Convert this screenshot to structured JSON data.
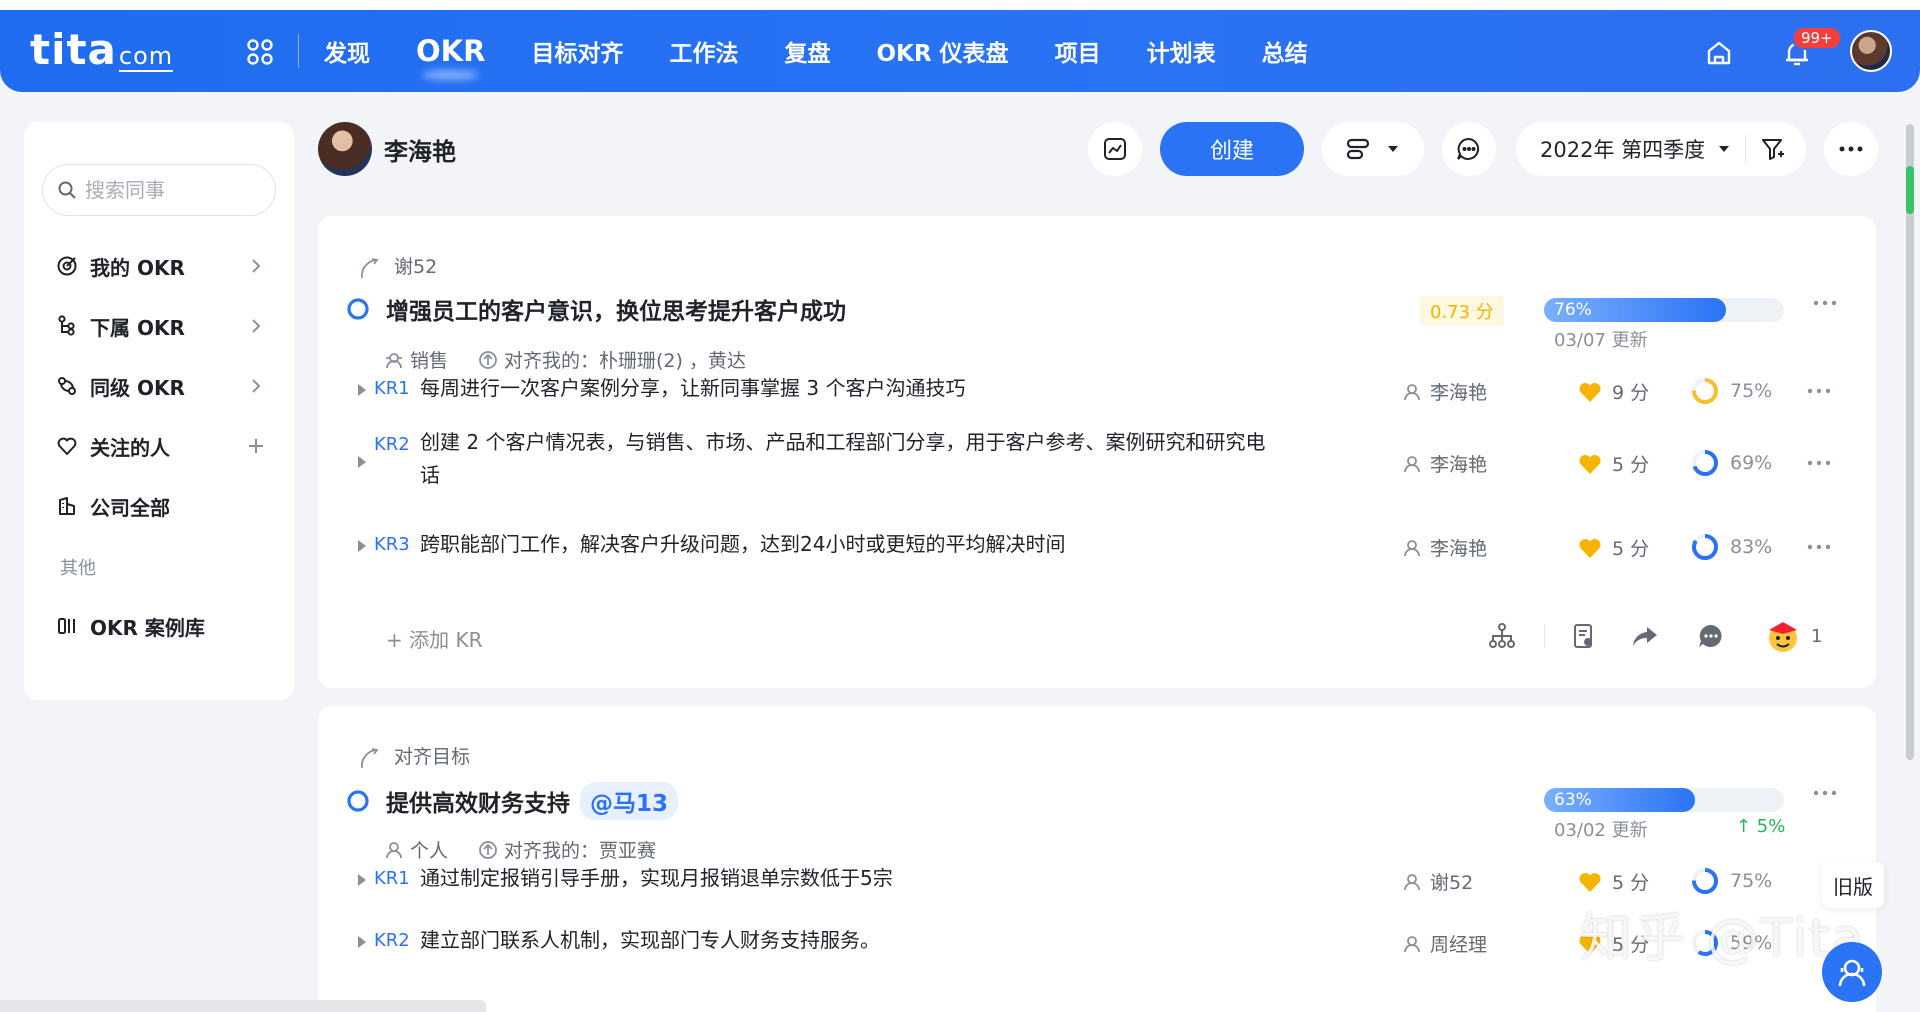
{
  "topbar": {
    "logo_main": "tita",
    "logo_suffix": "com",
    "nav": [
      "发现",
      "OKR",
      "目标对齐",
      "工作法",
      "复盘",
      "OKR 仪表盘",
      "项目",
      "计划表",
      "总结"
    ],
    "active_nav": "OKR",
    "notification_badge": "99+"
  },
  "sidebar": {
    "search_placeholder": "搜索同事",
    "items": [
      {
        "label": "我的 OKR",
        "icon": "target-icon"
      },
      {
        "label": "下属 OKR",
        "icon": "org-tree-icon"
      },
      {
        "label": "同级 OKR",
        "icon": "peers-icon"
      },
      {
        "label": "关注的人",
        "icon": "heart-icon"
      },
      {
        "label": "公司全部",
        "icon": "building-icon"
      }
    ],
    "section_other": "其他",
    "case_library": "OKR 案例库"
  },
  "header": {
    "user_name": "李海艳",
    "create_label": "创建",
    "period_label": "2022年 第四季度"
  },
  "objectives": [
    {
      "parent_label": "谢52",
      "title": "增强员工的客户意识，换位思考提升客户成功",
      "mention": "",
      "score": "0.73 分",
      "progress_label": "76%",
      "progress": 0.76,
      "updated": "03/07 更新",
      "trend": "",
      "type_label": "销售",
      "aligned_label": "对齐我的：朴珊珊(2) ，黄达",
      "krs": [
        {
          "tag": "KR1",
          "text": "每周进行一次客户案例分享，让新同事掌握 3 个客户沟通技巧",
          "owner": "李海艳",
          "score": "9 分",
          "pct": "75%"
        },
        {
          "tag": "KR2",
          "text": "创建 2 个客户情况表，与销售、市场、产品和工程部门分享，用于客户参考、案例研究和研究电话",
          "owner": "李海艳",
          "score": "5 分",
          "pct": "69%"
        },
        {
          "tag": "KR3",
          "text": "跨职能部门工作，解决客户升级问题，达到24小时或更短的平均解决时间",
          "owner": "李海艳",
          "score": "5 分",
          "pct": "83%"
        }
      ],
      "add_kr": "+ 添加 KR",
      "reaction_count": "1"
    },
    {
      "parent_label": "对齐目标",
      "title": "提供高效财务支持",
      "mention": "@马13",
      "score": "",
      "progress_label": "63%",
      "progress": 0.63,
      "updated": "03/02 更新",
      "trend": "↑ 5%",
      "type_label": "个人",
      "aligned_label": "对齐我的：贾亚赛",
      "krs": [
        {
          "tag": "KR1",
          "text": "通过制定报销引导手册，实现月报销退单宗数低于5宗",
          "owner": "谢52",
          "score": "5 分",
          "pct": "75%"
        },
        {
          "tag": "KR2",
          "text": "建立部门联系人机制，实现部门专人财务支持服务。",
          "owner": "周经理",
          "score": "5 分",
          "pct": "59%"
        }
      ]
    }
  ],
  "overlay": {
    "old_version": "旧版",
    "watermark": "知乎 @Tita"
  },
  "colors": {
    "brand": "#2a73f5",
    "score_yellow": "#f6b300",
    "trend_green": "#27b35a"
  }
}
